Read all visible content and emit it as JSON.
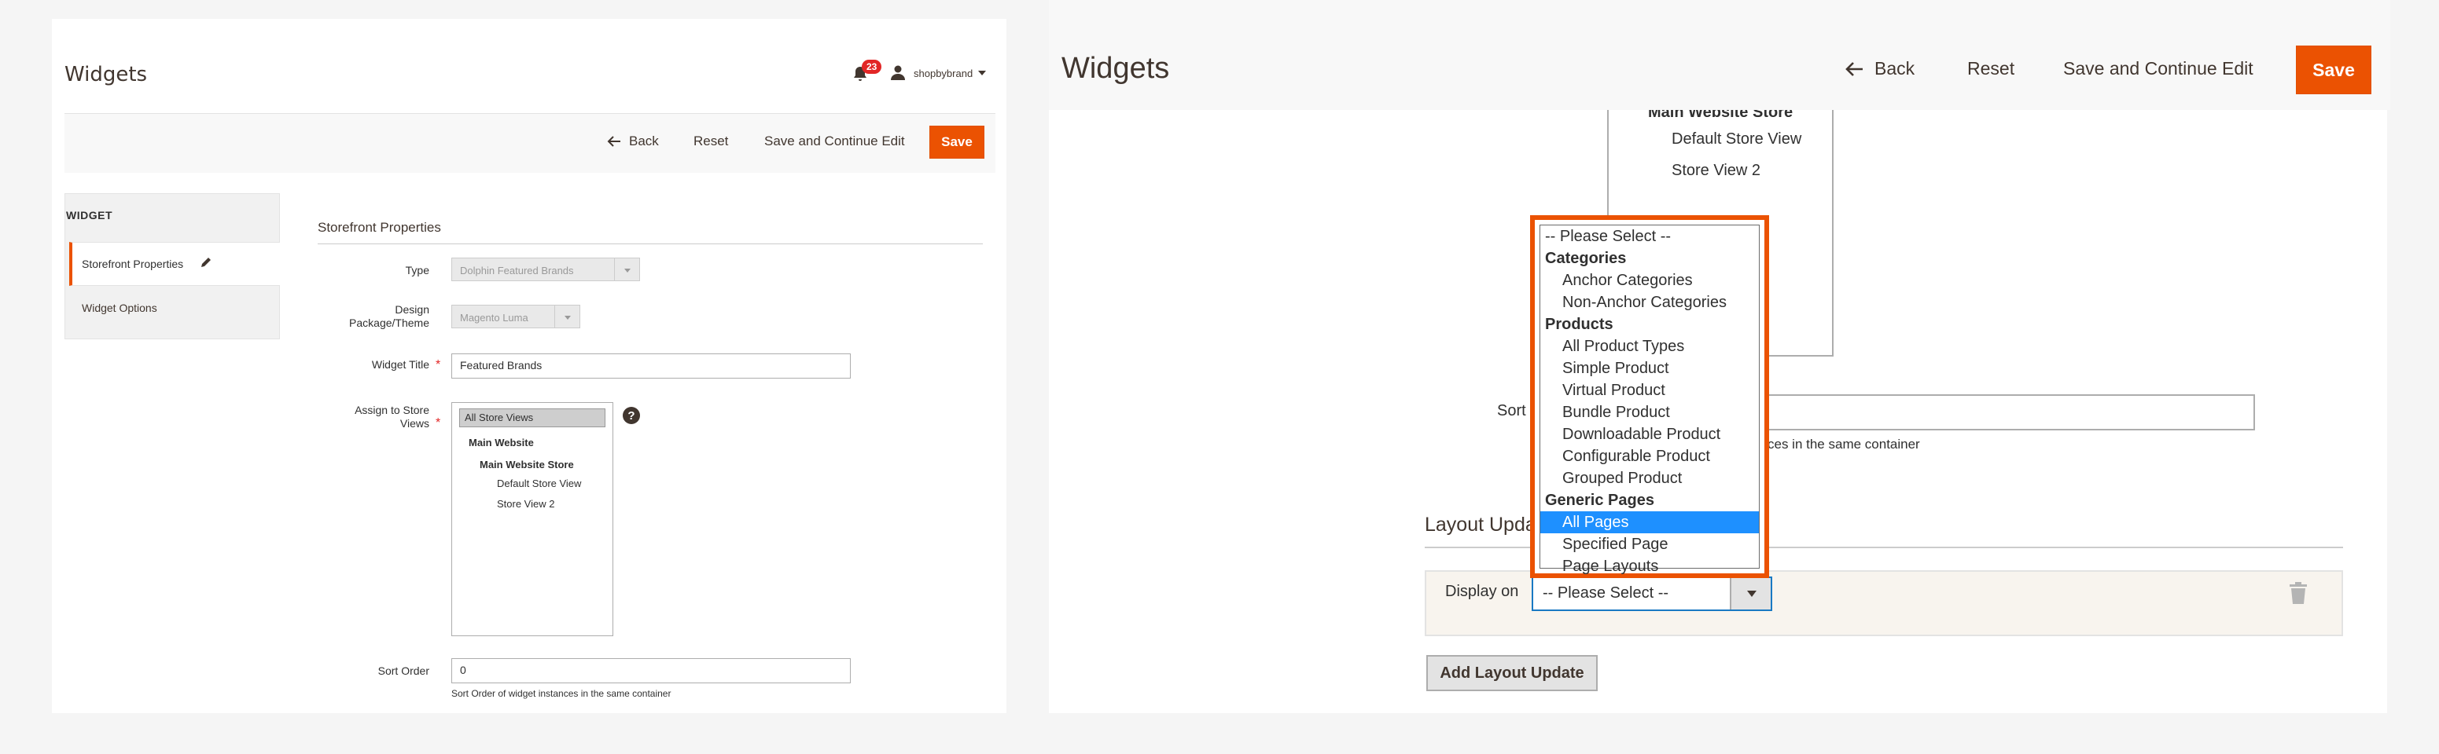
{
  "left": {
    "title": "Widgets",
    "notification_count": "23",
    "user_name": "shopbybrand",
    "actions": {
      "back": "Back",
      "reset": "Reset",
      "save_continue": "Save and Continue Edit",
      "save": "Save"
    },
    "sidebar": {
      "heading": "WIDGET",
      "active_item": "Storefront Properties",
      "item2": "Widget Options"
    },
    "section_title": "Storefront Properties",
    "fields": {
      "type_label": "Type",
      "type_value": "Dolphin Featured Brands",
      "design_label_1": "Design",
      "design_label_2": "Package/Theme",
      "design_value": "Magento Luma",
      "title_label": "Widget Title",
      "title_value": "Featured Brands",
      "store_label_1": "Assign to Store",
      "store_label_2": "Views",
      "store_options": {
        "all": "All Store Views",
        "website": "Main Website",
        "store": "Main Website Store",
        "default_view": "Default Store View",
        "view2": "Store View 2"
      },
      "sort_label": "Sort Order",
      "sort_value": "0",
      "sort_note": "Sort Order of widget instances in the same container"
    },
    "required_mark": "*",
    "help_mark": "?"
  },
  "right": {
    "title": "Widgets",
    "actions": {
      "back": "Back",
      "reset": "Reset",
      "save_continue": "Save and Continue Edit",
      "save": "Save"
    },
    "store_options": {
      "store": "Main Website Store",
      "default_view": "Default Store View",
      "view2": "Store View 2"
    },
    "sort_label_partial": "Sort",
    "sort_note_partial": "ces in the same container",
    "layout_heading_partial": "Layout Upda",
    "display_on_label": "Display on",
    "display_on_value": "-- Please Select --",
    "add_layout_button": "Add Layout Update",
    "dropdown": {
      "please_select": "-- Please Select --",
      "group_categories": "Categories",
      "anchor": "Anchor Categories",
      "non_anchor": "Non-Anchor Categories",
      "group_products": "Products",
      "all_products": "All Product Types",
      "simple": "Simple Product",
      "virtual": "Virtual Product",
      "bundle": "Bundle Product",
      "downloadable": "Downloadable Product",
      "configurable": "Configurable Product",
      "grouped": "Grouped Product",
      "group_generic": "Generic Pages",
      "all_pages": "All Pages",
      "specified": "Specified Page",
      "layouts": "Page Layouts"
    }
  },
  "colors": {
    "accent": "#eb5202",
    "highlight": "#1e90ff",
    "required": "#e22626"
  }
}
